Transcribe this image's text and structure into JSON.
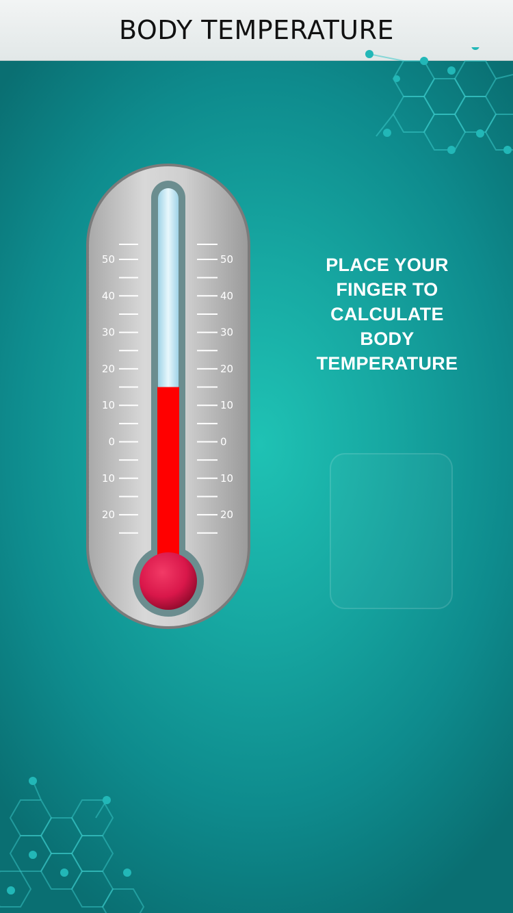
{
  "header": {
    "title": "BODY TEMPERATURE"
  },
  "instruction": {
    "text": "PLACE YOUR FINGER TO CALCULATE BODY TEMPERATURE"
  },
  "thermometer": {
    "scale_labels": [
      "50",
      "40",
      "30",
      "20",
      "10",
      "0",
      "10",
      "20"
    ],
    "fill_color": "#ff0000",
    "bulb_color": "#d9174a",
    "level_scale_value": 15
  },
  "colors": {
    "accent": "#17a8a2",
    "header_bg": "#eef1f1"
  }
}
